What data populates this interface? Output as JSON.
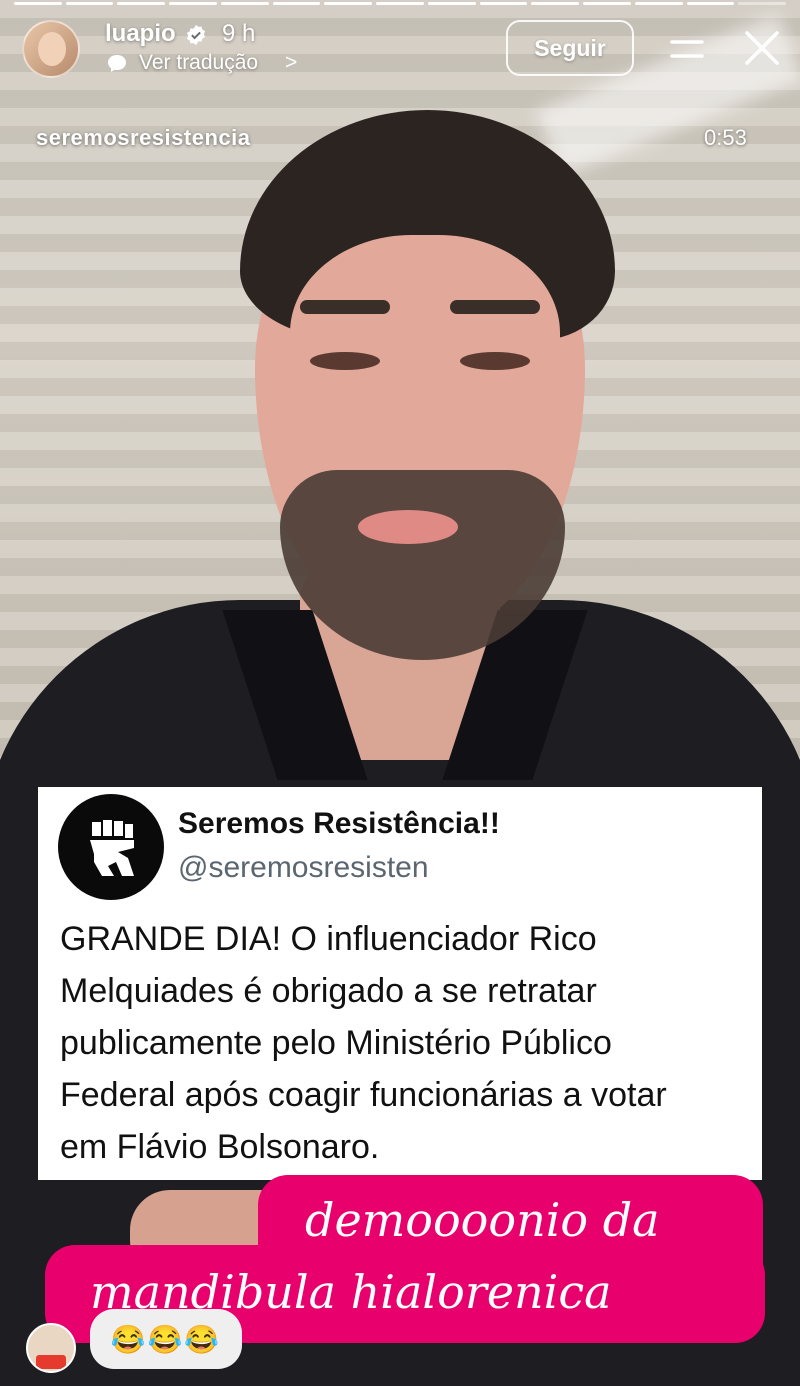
{
  "header": {
    "username": "luapio",
    "time_ago": "9 h",
    "translate_label": "Ver tradução",
    "translate_chevron": ">",
    "follow_label": "Seguir",
    "source_username": "seremosresistencia",
    "duration": "0:53"
  },
  "progress": {
    "segments": 15,
    "completed": 14
  },
  "tweet": {
    "name": "Seremos Resistência!!",
    "handle": "@seremosresisten",
    "lines": [
      "GRANDE DIA! O influenciador Rico",
      "Melquiades é obrigado a se retratar",
      "publicamente pelo Ministério Público",
      "Federal após coagir funcionárias a votar",
      "em Flávio Bolsonaro."
    ]
  },
  "sticker": {
    "line1": "demoooonio da",
    "line2": "mandibula hialorenica",
    "color": "#e8006d"
  },
  "reaction": {
    "emojis": "😂😂😂"
  },
  "icons": [
    "verified-badge-icon",
    "translate-icon",
    "menu-icon",
    "close-icon",
    "raised-fist-logo-icon"
  ]
}
